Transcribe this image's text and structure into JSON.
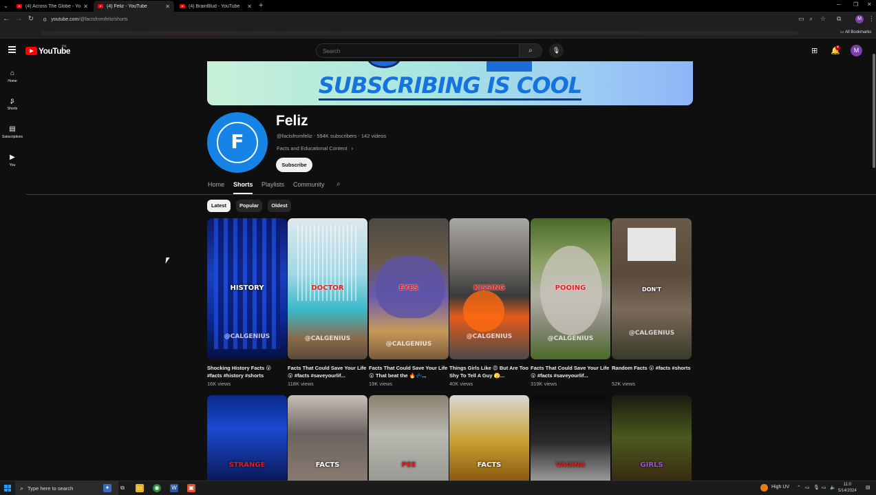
{
  "browser": {
    "tabs": [
      {
        "title": "(4) Across The Globe - YouTube"
      },
      {
        "title": "(4) Feliz - YouTube"
      },
      {
        "title": "(4) BrainBlud - YouTube"
      }
    ],
    "url_host": "youtube.com",
    "url_path": "/@factsfromfeliz/shorts",
    "all_bookmarks": "All Bookmarks",
    "profile_initial": "M"
  },
  "masthead": {
    "logo_text": "YouTube",
    "country_code": "PK",
    "search_placeholder": "Search",
    "notification_count": "4",
    "avatar_initial": "M"
  },
  "guide": [
    {
      "label": "Home",
      "icon": "home-icon"
    },
    {
      "label": "Shorts",
      "icon": "shorts-icon"
    },
    {
      "label": "Subscriptions",
      "icon": "subscriptions-icon"
    },
    {
      "label": "You",
      "icon": "you-icon"
    }
  ],
  "banner": {
    "text": "SUBSCRIBING IS COOL"
  },
  "channel": {
    "name": "Feliz",
    "handle": "@factsfromfeliz",
    "subscribers": "594K subscribers",
    "videos": "142 videos",
    "description": "Facts and Educational Content",
    "subscribe_label": "Subscribe"
  },
  "tabs": [
    "Home",
    "Shorts",
    "Playlists",
    "Community"
  ],
  "chips": [
    "Latest",
    "Popular",
    "Oldest"
  ],
  "shorts_row1": [
    {
      "overlay": "HISTORY",
      "watermark": "@CALGENIUS",
      "title": "Shocking History Facts 😮 #facts #history #shorts",
      "views": "16K views"
    },
    {
      "overlay": "DOCTOR",
      "watermark": "@CALGENIUS",
      "title": "Facts That Could Save Your Life 😮 #facts #saveyourlif...",
      "views": "118K views"
    },
    {
      "overlay": "EYES",
      "watermark": "@CALGENIUS",
      "title": "Facts That Could Save Your Life 😮 That beat the 🔥💤...",
      "views": "19K views"
    },
    {
      "overlay": "KISSING",
      "watermark": "@CALGENIUS",
      "title": "Things Girls Like 😍 But Are Too Shy To Tell A Guy 🫣...",
      "views": "40K views"
    },
    {
      "overlay": "POOING",
      "watermark": "@CALGENIUS",
      "title": "Facts That Could Save Your Life 😮 #facts #saveyourlif...",
      "views": "319K views"
    },
    {
      "overlay": "DON'T",
      "watermark": "@CALGENIUS",
      "title": "Random Facts 😮 #facts #shorts",
      "views": "52K views"
    }
  ],
  "shorts_row2": [
    {
      "overlay": "STRANGE"
    },
    {
      "overlay": "FACTS"
    },
    {
      "overlay": "PEE"
    },
    {
      "overlay": "FACTS"
    },
    {
      "overlay": "VAGINA"
    },
    {
      "overlay": "GIRLS"
    }
  ],
  "taskbar": {
    "search_placeholder": "Type here to search",
    "weather": "High UV",
    "time": "11:0",
    "date": "5/14/2024"
  }
}
